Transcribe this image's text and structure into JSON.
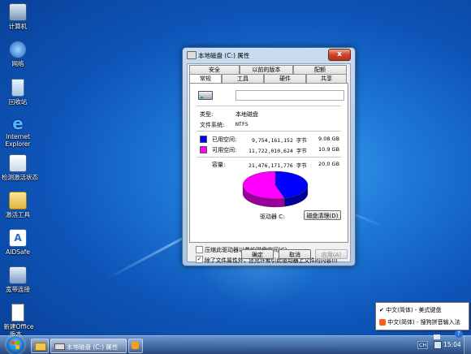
{
  "desktop": {
    "icons": [
      {
        "label": "计算机",
        "icon": "computer-icon"
      },
      {
        "label": "网络",
        "icon": "network-icon"
      },
      {
        "label": "回收站",
        "icon": "recycle-bin-icon"
      },
      {
        "label": "Internet Explorer",
        "icon": "ie-icon"
      },
      {
        "label": "检测激活状态",
        "icon": "activation-icon"
      },
      {
        "label": "激活工具",
        "icon": "folder-icon"
      },
      {
        "label": "AIDSafe",
        "icon": "shield-app-icon"
      },
      {
        "label": "宽带连接",
        "icon": "broadband-icon"
      },
      {
        "label": "新建Office版本...",
        "icon": "document-icon"
      }
    ]
  },
  "dialog": {
    "title": "本地磁盘 (C:) 属性",
    "close_label": "x",
    "tabs_top": [
      "安全",
      "以前的版本",
      "配额"
    ],
    "tabs_bottom": [
      "常规",
      "工具",
      "硬件",
      "共享"
    ],
    "active_tab": "常规",
    "name_value": "",
    "type_label": "类型:",
    "type_value": "本地磁盘",
    "fs_label": "文件系统:",
    "fs_value": "NTFS",
    "used": {
      "label": "已用空间:",
      "bytes": "9,754,161,152 字节",
      "size": "9.08 GB",
      "color": "#0000ff"
    },
    "free": {
      "label": "可用空间:",
      "bytes": "11,722,010,624 字节",
      "size": "10.9 GB",
      "color": "#ff00ff"
    },
    "capacity": {
      "label": "容量:",
      "bytes": "21,476,171,776 字节",
      "size": "20.0 GB"
    },
    "drive_label": "驱动器 C:",
    "cleanup_button": "磁盘清理(D)",
    "compress_option": "压缩此驱动器以节约磁盘空间(C)",
    "compress_checked": false,
    "index_option": "除了文件属性外，还允许索引此驱动器上文件的内容(I)",
    "index_checked": true,
    "ok_button": "确定",
    "cancel_button": "取消",
    "apply_button": "应用(A)"
  },
  "ime_popup": {
    "items": [
      {
        "label": "中文(简体) - 美式键盘",
        "checked": true
      },
      {
        "label": "中文(简体) - 搜狗拼音输入法",
        "checked": false
      }
    ]
  },
  "taskbar": {
    "window_label": "本地磁盘 (C:) 属性",
    "lang": "CH",
    "clock": "15:04"
  },
  "chart_data": {
    "type": "pie",
    "categories": [
      "已用空间",
      "可用空间"
    ],
    "values": [
      9754161152,
      11722010624
    ],
    "colors": [
      "#0000ff",
      "#ff00ff"
    ]
  }
}
